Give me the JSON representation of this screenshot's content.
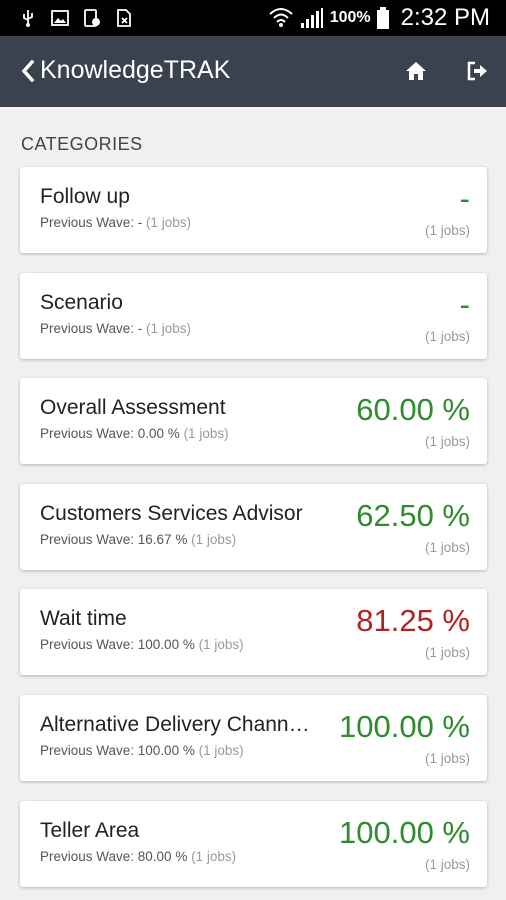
{
  "status_bar": {
    "battery": "100%",
    "time": "2:32 PM",
    "icons": [
      "usb-icon",
      "image-icon",
      "device-settings-icon",
      "file-x-icon",
      "wifi-icon",
      "signal-icon",
      "battery-icon"
    ]
  },
  "app_bar": {
    "title": "KnowledgeTRAK",
    "back_icon": "chevron-left-icon",
    "home_icon": "home-icon",
    "logout_icon": "sign-out-icon"
  },
  "section": {
    "title": "CATEGORIES"
  },
  "colors": {
    "good": "#2e8b2e",
    "bad": "#b22222",
    "appbar": "#3a4250"
  },
  "categories": [
    {
      "name": "Follow up",
      "previous": "Previous Wave: -",
      "prev_jobs": " (1 jobs)",
      "value": "-",
      "jobs": "(1 jobs)",
      "status": "good"
    },
    {
      "name": "Scenario",
      "previous": "Previous Wave: -",
      "prev_jobs": " (1 jobs)",
      "value": "-",
      "jobs": "(1 jobs)",
      "status": "good"
    },
    {
      "name": "Overall Assessment",
      "previous": "Previous Wave: 0.00 %",
      "prev_jobs": " (1 jobs)",
      "value": "60.00 %",
      "jobs": "(1 jobs)",
      "status": "good"
    },
    {
      "name": "Customers Services Advisor",
      "previous": "Previous Wave: 16.67 %",
      "prev_jobs": " (1 jobs)",
      "value": "62.50 %",
      "jobs": "(1 jobs)",
      "status": "good"
    },
    {
      "name": "Wait time",
      "previous": "Previous Wave: 100.00 %",
      "prev_jobs": " (1 jobs)",
      "value": "81.25 %",
      "jobs": "(1 jobs)",
      "status": "bad"
    },
    {
      "name": "Alternative Delivery Chann…",
      "previous": "Previous Wave: 100.00 %",
      "prev_jobs": " (1 jobs)",
      "value": "100.00 %",
      "jobs": "(1 jobs)",
      "status": "good"
    },
    {
      "name": "Teller Area",
      "previous": "Previous Wave: 80.00 %",
      "prev_jobs": " (1 jobs)",
      "value": "100.00 %",
      "jobs": "(1 jobs)",
      "status": "good"
    }
  ]
}
